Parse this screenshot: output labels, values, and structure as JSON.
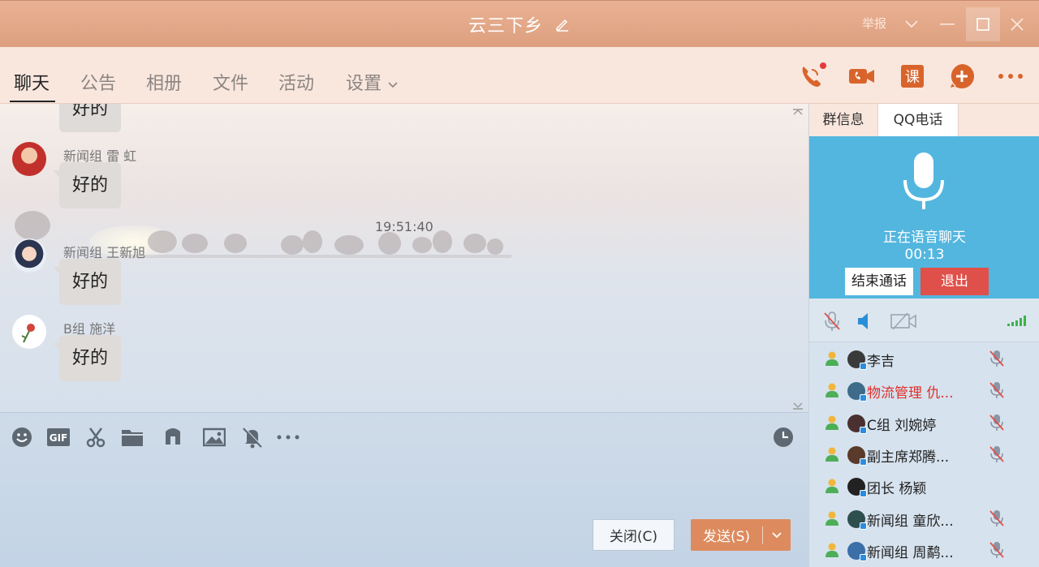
{
  "window": {
    "title": "云三下乡",
    "report_label": "举报"
  },
  "tabs": [
    {
      "label": "聊天"
    },
    {
      "label": "公告"
    },
    {
      "label": "相册"
    },
    {
      "label": "文件"
    },
    {
      "label": "活动"
    },
    {
      "label": "设置"
    }
  ],
  "actions": [
    "phone-call-icon",
    "video-call-icon",
    "lesson-icon",
    "add-icon",
    "more-icon"
  ],
  "chat": {
    "lesson_glyph": "课",
    "timestamp": "19:51:40",
    "messages": [
      {
        "sender": "",
        "text": "好的"
      },
      {
        "sender": "新闻组  雷 虹",
        "text": "好的"
      },
      {
        "sender": "新闻组 王新旭",
        "text": "好的"
      },
      {
        "sender": "B组 施洋",
        "text": "好的"
      }
    ]
  },
  "toolbar": {
    "gif_label": "GIF",
    "close_label": "关闭(C)",
    "send_label": "发送(S)"
  },
  "right_panel": {
    "tabs": [
      {
        "label": "群信息"
      },
      {
        "label": "QQ电话"
      }
    ],
    "voice_status": "正在语音聊天",
    "voice_time": "00:13",
    "end_call_label": "结束通话",
    "exit_label": "退出",
    "members": [
      {
        "name": "李吉",
        "highlight": false,
        "muted": true
      },
      {
        "name": "物流管理  仇...",
        "highlight": true,
        "muted": true
      },
      {
        "name": "C组 刘婉婷",
        "highlight": false,
        "muted": true
      },
      {
        "name": "副主席郑腾...",
        "highlight": false,
        "muted": true
      },
      {
        "name": "团长 杨颖",
        "highlight": false,
        "muted": false
      },
      {
        "name": "新闻组 童欣...",
        "highlight": false,
        "muted": true
      },
      {
        "name": "新闻组 周鹬...",
        "highlight": false,
        "muted": true
      }
    ]
  },
  "colors": {
    "titlebar": "#dda07f",
    "accent": "#d9642b",
    "voice_panel": "#53b6df",
    "exit_button": "#e0504a",
    "send_button": "#dd8b5e"
  }
}
